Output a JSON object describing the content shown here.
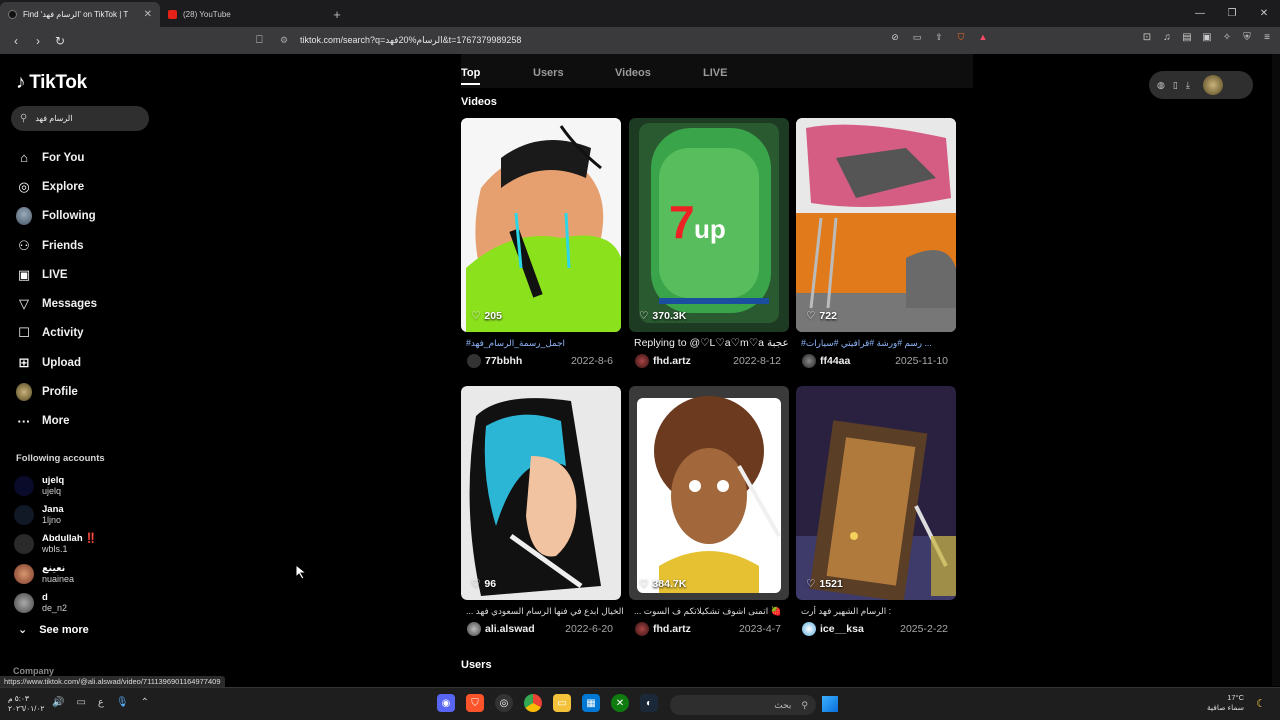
{
  "browser": {
    "tabs": [
      {
        "title": "Find 'الرسام فهد' on TikTok | T",
        "active": true
      },
      {
        "title": "(28) YouTube",
        "active": false
      }
    ],
    "url": "tiktok.com/search?q=الرسام%20فهد&t=1767379989258",
    "status_url": "https://www.tiktok.com/@ali.alswad/video/7111396901164977409"
  },
  "sidebar": {
    "logo": "TikTok",
    "search_value": "الرسام فهد",
    "menu": [
      {
        "label": "For You",
        "icon": "home-icon"
      },
      {
        "label": "Explore",
        "icon": "compass-icon"
      },
      {
        "label": "Following",
        "icon": "avatar"
      },
      {
        "label": "Friends",
        "icon": "friends-icon"
      },
      {
        "label": "LIVE",
        "icon": "live-icon"
      },
      {
        "label": "Messages",
        "icon": "messages-icon"
      },
      {
        "label": "Activity",
        "icon": "activity-icon"
      },
      {
        "label": "Upload",
        "icon": "upload-icon"
      },
      {
        "label": "Profile",
        "icon": "profile-avatar"
      },
      {
        "label": "More",
        "icon": "more-icon"
      }
    ],
    "following_title": "Following accounts",
    "accounts": [
      {
        "name": "ujelq",
        "username": "ujelq"
      },
      {
        "name": "Jana",
        "username": "1ljno"
      },
      {
        "name": "Abdullah ‼️",
        "username": "wbls.1"
      },
      {
        "name": "نعينع",
        "username": "nuainea"
      },
      {
        "name": "d",
        "username": "de_n2"
      }
    ],
    "see_more": "See more",
    "company": "Company"
  },
  "search_tabs": [
    "Top",
    "Users",
    "Videos",
    "LIVE"
  ],
  "sections": {
    "videos": "Videos",
    "users": "Users"
  },
  "videos": [
    {
      "likes": "205",
      "caption": "#اجمل_رسمة_الرسام_فهد",
      "user": "77bbhh",
      "date": "2022-8-6"
    },
    {
      "likes": "370.3K",
      "caption": "Replying to @♡L♡a♡m♡a عجبة ...",
      "user": "fhd.artz",
      "date": "2022-8-12"
    },
    {
      "likes": "722",
      "caption": "#رسم #ورشة #قرافيتي #سيارات ...",
      "user": "ff44aa",
      "date": "2025-11-10"
    },
    {
      "likes": "96",
      "caption": "... الخيال ابدع في فنها الرسام السعودي فهد",
      "user": "ali.alswad",
      "date": "2022-6-20"
    },
    {
      "likes": "384.7K",
      "caption": "... اتمنى اشوف تشكيلاتكم ف السوت 🍓",
      "user": "fhd.artz",
      "date": "2023-4-7"
    },
    {
      "likes": "1521",
      "caption": "الرسام الشهير فهد أرت :",
      "user": "ice__ksa",
      "date": "2025-2-22"
    }
  ],
  "taskbar": {
    "time": "٥:٠٣ م",
    "date": "٢٠٢٦/٠١/٠٢",
    "lang": "ع",
    "search_placeholder": "بحث",
    "temperature": "17°C",
    "weather": "سماء صافية"
  }
}
